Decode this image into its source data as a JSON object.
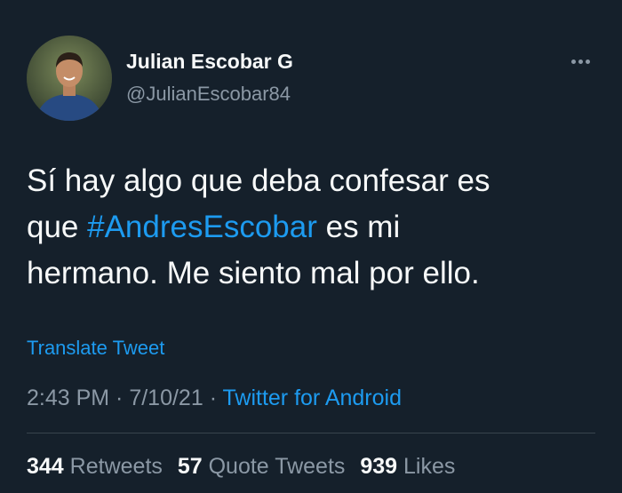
{
  "author": {
    "name": "Julian Escobar G",
    "handle": "@JulianEscobar84"
  },
  "tweet": {
    "line1": "Sí hay algo que deba confesar es",
    "line2_prefix": "que ",
    "hashtag": "#AndresEscobar",
    "line2_suffix": " es mi",
    "line3": "hermano. Me siento mal por ello."
  },
  "translate_label": "Translate Tweet",
  "meta": {
    "time": "2:43 PM",
    "sep1": " · ",
    "date": "7/10/21",
    "sep2": " · ",
    "source": "Twitter for Android"
  },
  "stats": {
    "retweets_count": "344",
    "retweets_label": "Retweets",
    "quotes_count": "57",
    "quotes_label": "Quote Tweets",
    "likes_count": "939",
    "likes_label": "Likes"
  },
  "colors": {
    "background": "#15202b",
    "text": "#f7f9f9",
    "secondary": "#8b98a5",
    "accent": "#1d9bf0"
  },
  "icons": {
    "more": "more-options-icon",
    "avatar": "profile-avatar"
  }
}
